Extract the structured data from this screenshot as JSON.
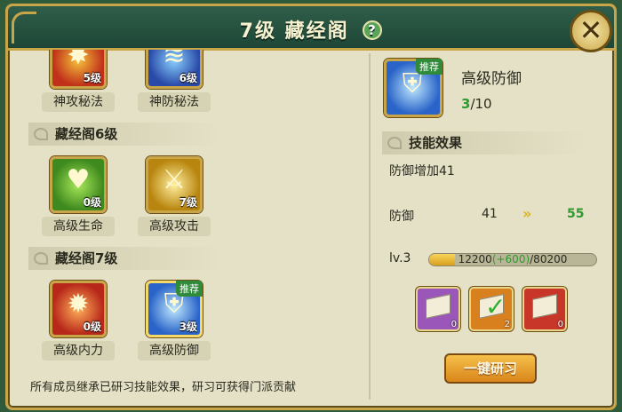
{
  "title": {
    "level": "7级",
    "name": "藏经阁",
    "help_icon": "question-circle-icon",
    "close_icon": "close-x-icon"
  },
  "sections": [
    {
      "header": "",
      "skills": [
        {
          "name": "神攻秘法",
          "level": "5级",
          "icon": "sword-burst-icon",
          "color": "#c0301a"
        },
        {
          "name": "神防秘法",
          "level": "6级",
          "icon": "shield-wave-icon",
          "color": "#2a4aa8"
        }
      ]
    },
    {
      "header": "藏经阁6级",
      "skills": [
        {
          "name": "高级生命",
          "level": "0级",
          "icon": "heart-plus-icon",
          "color": "#3f8a1e"
        },
        {
          "name": "高级攻击",
          "level": "7级",
          "icon": "golden-swords-icon",
          "color": "#b8850e"
        }
      ]
    },
    {
      "header": "藏经阁7级",
      "skills": [
        {
          "name": "高级内力",
          "level": "0级",
          "icon": "warrior-burst-icon",
          "color": "#b8281a"
        },
        {
          "name": "高级防御",
          "level": "3级",
          "icon": "shield-slash-icon",
          "color": "#2a64c8",
          "badge": "推荐"
        }
      ]
    }
  ],
  "footer_note": "所有成员继承已研习技能效果，研习可获得门派贡献",
  "detail": {
    "name": "高级防御",
    "badge": "推荐",
    "progress_current": "3",
    "progress_max": "/10",
    "effect_header": "技能效果",
    "effect_desc": "防御增加41",
    "stat": {
      "name": "防御",
      "from": "41",
      "arrow": "»",
      "to": "55"
    },
    "level_label": "lv.3",
    "exp_current": "12200",
    "exp_gain": "(+600)",
    "exp_max": "/80200",
    "exp_fraction": 0.152
  },
  "materials": [
    {
      "icon": "scroll-book-icon",
      "color": "#9a56b8",
      "count": "0"
    },
    {
      "icon": "checkmark-icon",
      "color": "#d9801e",
      "count": "2"
    },
    {
      "icon": "scroll-book-icon",
      "color": "#c8362a",
      "count": "0"
    }
  ],
  "oneclick_label": "一键研习"
}
